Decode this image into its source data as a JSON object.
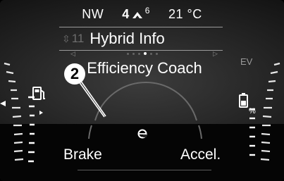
{
  "status": {
    "compass": "NW",
    "gear_current": "4",
    "gear_max": "6",
    "temperature": "21 °C"
  },
  "menu": {
    "page_number": "11",
    "title": "Hybrid Info",
    "subtitle": "Efficiency Coach",
    "page_dots": 6,
    "active_dot": 4
  },
  "ev_label": "EV",
  "callout_number": "2",
  "gauge": {
    "left_label": "Brake",
    "right_label": "Accel.",
    "center_icon": "eco-leaf-icon"
  },
  "icons": {
    "fuel": "fuel-pump-icon",
    "battery": "battery-percent-icon"
  }
}
